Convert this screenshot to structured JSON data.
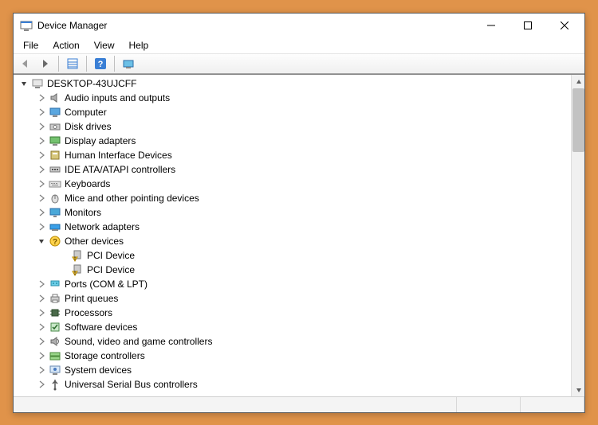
{
  "window": {
    "title": "Device Manager"
  },
  "menu": {
    "file": "File",
    "action": "Action",
    "view": "View",
    "help": "Help"
  },
  "tree": {
    "root": {
      "label": "DESKTOP-43UJCFF",
      "expanded": true
    },
    "categories": [
      {
        "label": "Audio inputs and outputs",
        "icon": "audio",
        "expanded": false
      },
      {
        "label": "Computer",
        "icon": "computer",
        "expanded": false
      },
      {
        "label": "Disk drives",
        "icon": "disk",
        "expanded": false
      },
      {
        "label": "Display adapters",
        "icon": "display",
        "expanded": false
      },
      {
        "label": "Human Interface Devices",
        "icon": "hid",
        "expanded": false
      },
      {
        "label": "IDE ATA/ATAPI controllers",
        "icon": "ide",
        "expanded": false
      },
      {
        "label": "Keyboards",
        "icon": "keyboard",
        "expanded": false
      },
      {
        "label": "Mice and other pointing devices",
        "icon": "mouse",
        "expanded": false
      },
      {
        "label": "Monitors",
        "icon": "monitor",
        "expanded": false
      },
      {
        "label": "Network adapters",
        "icon": "network",
        "expanded": false
      },
      {
        "label": "Other devices",
        "icon": "other",
        "expanded": true,
        "children": [
          {
            "label": "PCI Device",
            "icon": "warning"
          },
          {
            "label": "PCI Device",
            "icon": "warning"
          }
        ]
      },
      {
        "label": "Ports (COM & LPT)",
        "icon": "ports",
        "expanded": false
      },
      {
        "label": "Print queues",
        "icon": "printer",
        "expanded": false
      },
      {
        "label": "Processors",
        "icon": "processor",
        "expanded": false
      },
      {
        "label": "Software devices",
        "icon": "software",
        "expanded": false
      },
      {
        "label": "Sound, video and game controllers",
        "icon": "sound",
        "expanded": false
      },
      {
        "label": "Storage controllers",
        "icon": "storage",
        "expanded": false
      },
      {
        "label": "System devices",
        "icon": "system",
        "expanded": false
      },
      {
        "label": "Universal Serial Bus controllers",
        "icon": "usb",
        "expanded": false
      }
    ]
  }
}
